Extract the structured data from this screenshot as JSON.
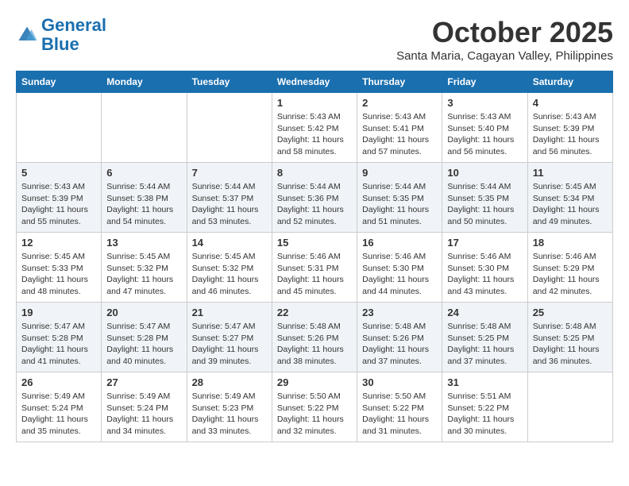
{
  "header": {
    "logo_line1": "General",
    "logo_line2": "Blue",
    "month": "October 2025",
    "location": "Santa Maria, Cagayan Valley, Philippines"
  },
  "days_of_week": [
    "Sunday",
    "Monday",
    "Tuesday",
    "Wednesday",
    "Thursday",
    "Friday",
    "Saturday"
  ],
  "weeks": [
    [
      {
        "day": "",
        "info": ""
      },
      {
        "day": "",
        "info": ""
      },
      {
        "day": "",
        "info": ""
      },
      {
        "day": "1",
        "info": "Sunrise: 5:43 AM\nSunset: 5:42 PM\nDaylight: 11 hours\nand 58 minutes."
      },
      {
        "day": "2",
        "info": "Sunrise: 5:43 AM\nSunset: 5:41 PM\nDaylight: 11 hours\nand 57 minutes."
      },
      {
        "day": "3",
        "info": "Sunrise: 5:43 AM\nSunset: 5:40 PM\nDaylight: 11 hours\nand 56 minutes."
      },
      {
        "day": "4",
        "info": "Sunrise: 5:43 AM\nSunset: 5:39 PM\nDaylight: 11 hours\nand 56 minutes."
      }
    ],
    [
      {
        "day": "5",
        "info": "Sunrise: 5:43 AM\nSunset: 5:39 PM\nDaylight: 11 hours\nand 55 minutes."
      },
      {
        "day": "6",
        "info": "Sunrise: 5:44 AM\nSunset: 5:38 PM\nDaylight: 11 hours\nand 54 minutes."
      },
      {
        "day": "7",
        "info": "Sunrise: 5:44 AM\nSunset: 5:37 PM\nDaylight: 11 hours\nand 53 minutes."
      },
      {
        "day": "8",
        "info": "Sunrise: 5:44 AM\nSunset: 5:36 PM\nDaylight: 11 hours\nand 52 minutes."
      },
      {
        "day": "9",
        "info": "Sunrise: 5:44 AM\nSunset: 5:35 PM\nDaylight: 11 hours\nand 51 minutes."
      },
      {
        "day": "10",
        "info": "Sunrise: 5:44 AM\nSunset: 5:35 PM\nDaylight: 11 hours\nand 50 minutes."
      },
      {
        "day": "11",
        "info": "Sunrise: 5:45 AM\nSunset: 5:34 PM\nDaylight: 11 hours\nand 49 minutes."
      }
    ],
    [
      {
        "day": "12",
        "info": "Sunrise: 5:45 AM\nSunset: 5:33 PM\nDaylight: 11 hours\nand 48 minutes."
      },
      {
        "day": "13",
        "info": "Sunrise: 5:45 AM\nSunset: 5:32 PM\nDaylight: 11 hours\nand 47 minutes."
      },
      {
        "day": "14",
        "info": "Sunrise: 5:45 AM\nSunset: 5:32 PM\nDaylight: 11 hours\nand 46 minutes."
      },
      {
        "day": "15",
        "info": "Sunrise: 5:46 AM\nSunset: 5:31 PM\nDaylight: 11 hours\nand 45 minutes."
      },
      {
        "day": "16",
        "info": "Sunrise: 5:46 AM\nSunset: 5:30 PM\nDaylight: 11 hours\nand 44 minutes."
      },
      {
        "day": "17",
        "info": "Sunrise: 5:46 AM\nSunset: 5:30 PM\nDaylight: 11 hours\nand 43 minutes."
      },
      {
        "day": "18",
        "info": "Sunrise: 5:46 AM\nSunset: 5:29 PM\nDaylight: 11 hours\nand 42 minutes."
      }
    ],
    [
      {
        "day": "19",
        "info": "Sunrise: 5:47 AM\nSunset: 5:28 PM\nDaylight: 11 hours\nand 41 minutes."
      },
      {
        "day": "20",
        "info": "Sunrise: 5:47 AM\nSunset: 5:28 PM\nDaylight: 11 hours\nand 40 minutes."
      },
      {
        "day": "21",
        "info": "Sunrise: 5:47 AM\nSunset: 5:27 PM\nDaylight: 11 hours\nand 39 minutes."
      },
      {
        "day": "22",
        "info": "Sunrise: 5:48 AM\nSunset: 5:26 PM\nDaylight: 11 hours\nand 38 minutes."
      },
      {
        "day": "23",
        "info": "Sunrise: 5:48 AM\nSunset: 5:26 PM\nDaylight: 11 hours\nand 37 minutes."
      },
      {
        "day": "24",
        "info": "Sunrise: 5:48 AM\nSunset: 5:25 PM\nDaylight: 11 hours\nand 37 minutes."
      },
      {
        "day": "25",
        "info": "Sunrise: 5:48 AM\nSunset: 5:25 PM\nDaylight: 11 hours\nand 36 minutes."
      }
    ],
    [
      {
        "day": "26",
        "info": "Sunrise: 5:49 AM\nSunset: 5:24 PM\nDaylight: 11 hours\nand 35 minutes."
      },
      {
        "day": "27",
        "info": "Sunrise: 5:49 AM\nSunset: 5:24 PM\nDaylight: 11 hours\nand 34 minutes."
      },
      {
        "day": "28",
        "info": "Sunrise: 5:49 AM\nSunset: 5:23 PM\nDaylight: 11 hours\nand 33 minutes."
      },
      {
        "day": "29",
        "info": "Sunrise: 5:50 AM\nSunset: 5:22 PM\nDaylight: 11 hours\nand 32 minutes."
      },
      {
        "day": "30",
        "info": "Sunrise: 5:50 AM\nSunset: 5:22 PM\nDaylight: 11 hours\nand 31 minutes."
      },
      {
        "day": "31",
        "info": "Sunrise: 5:51 AM\nSunset: 5:22 PM\nDaylight: 11 hours\nand 30 minutes."
      },
      {
        "day": "",
        "info": ""
      }
    ]
  ]
}
